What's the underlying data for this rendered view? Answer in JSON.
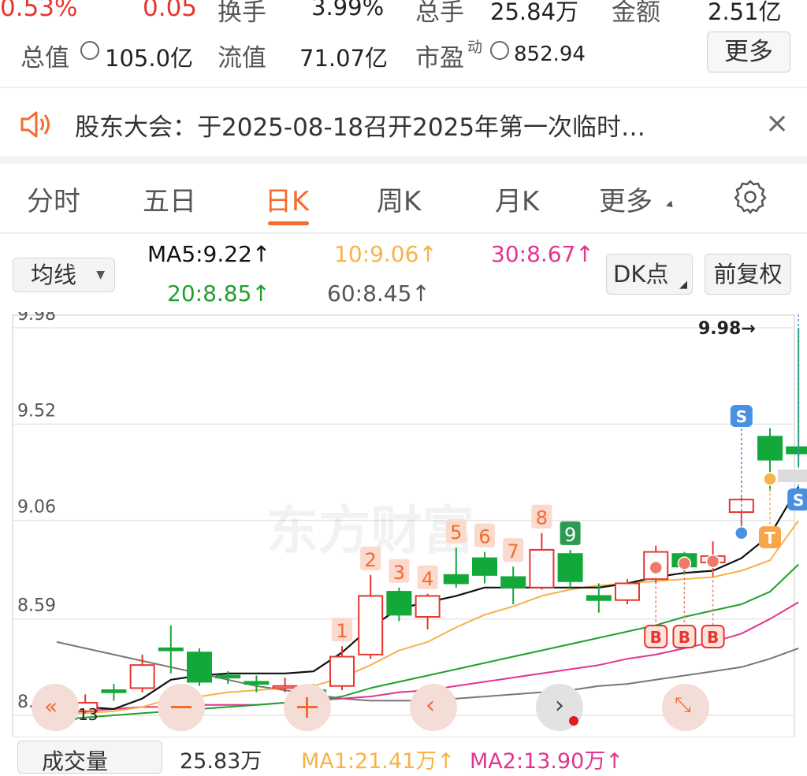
{
  "quote": {
    "change_pct": "0.53%",
    "change_amt": "0.05",
    "turnover_label": "换手",
    "turnover_value": "3.99%",
    "volume_label": "总手",
    "volume_value": "25.84万",
    "amount_label": "金额",
    "amount_value": "2.51亿",
    "mktcap_label": "总值",
    "mktcap_value": "105.0亿",
    "float_label": "流值",
    "float_value": "71.07亿",
    "pe_label": "市盈",
    "pe_sup": "动",
    "pe_value": "852.94",
    "more_button": "更多"
  },
  "notice": {
    "text": "股东大会：于2025-08-18召开2025年第一次临时…",
    "close_icon": "×"
  },
  "tabs": [
    {
      "label": "分时",
      "active": false
    },
    {
      "label": "五日",
      "active": false
    },
    {
      "label": "日K",
      "active": true
    },
    {
      "label": "周K",
      "active": false
    },
    {
      "label": "月K",
      "active": false
    },
    {
      "label": "更多",
      "active": false
    }
  ],
  "indicators": {
    "selector": "均线",
    "ma5": "MA5:9.22↑",
    "ma10": "10:9.06↑",
    "ma30": "30:8.67↑",
    "ma20": "20:8.85↑",
    "ma60": "60:8.45↑",
    "dk_button": "DK点",
    "adjust_button": "前复权"
  },
  "colors": {
    "up": "#e8352f",
    "down": "#13a83a",
    "accent": "#f36b2e",
    "ma5": "#111111",
    "ma10": "#f7b24a",
    "ma20": "#1fa12c",
    "ma30": "#e0358f",
    "ma60": "#777777"
  },
  "chart_data": {
    "type": "candlestick",
    "y_ticks": [
      "9.98",
      "9.52",
      "9.06",
      "8.59",
      "8.13"
    ],
    "ylim": [
      8.13,
      9.98
    ],
    "max_label": "9.98→",
    "low_label": "8.13",
    "watermark": "东方财富",
    "candles": [
      {
        "o": 8.11,
        "c": 8.13,
        "h": 8.14,
        "l": 8.1
      },
      {
        "o": 8.15,
        "c": 8.19,
        "h": 8.23,
        "l": 8.14
      },
      {
        "o": 8.25,
        "c": 8.24,
        "h": 8.28,
        "l": 8.2
      },
      {
        "o": 8.26,
        "c": 8.37,
        "h": 8.42,
        "l": 8.24
      },
      {
        "o": 8.45,
        "c": 8.44,
        "h": 8.56,
        "l": 8.33
      },
      {
        "o": 8.43,
        "c": 8.29,
        "h": 8.45,
        "l": 8.27
      },
      {
        "o": 8.32,
        "c": 8.31,
        "h": 8.34,
        "l": 8.28
      },
      {
        "o": 8.29,
        "c": 8.28,
        "h": 8.32,
        "l": 8.24
      },
      {
        "o": 8.27,
        "c": 8.27,
        "h": 8.31,
        "l": 8.24
      },
      {
        "o": 8.25,
        "c": 8.24,
        "h": 8.28,
        "l": 8.2
      },
      {
        "o": 8.27,
        "c": 8.41,
        "h": 8.46,
        "l": 8.25
      },
      {
        "o": 8.42,
        "c": 8.7,
        "h": 8.8,
        "l": 8.4
      },
      {
        "o": 8.72,
        "c": 8.61,
        "h": 8.74,
        "l": 8.58
      },
      {
        "o": 8.6,
        "c": 8.7,
        "h": 8.71,
        "l": 8.54
      },
      {
        "o": 8.8,
        "c": 8.76,
        "h": 8.93,
        "l": 8.74
      },
      {
        "o": 8.88,
        "c": 8.8,
        "h": 8.91,
        "l": 8.76
      },
      {
        "o": 8.79,
        "c": 8.74,
        "h": 8.84,
        "l": 8.66
      },
      {
        "o": 8.74,
        "c": 8.92,
        "h": 9.0,
        "l": 8.73
      },
      {
        "o": 8.9,
        "c": 8.77,
        "h": 8.92,
        "l": 8.74
      },
      {
        "o": 8.7,
        "c": 8.68,
        "h": 8.76,
        "l": 8.62
      },
      {
        "o": 8.68,
        "c": 8.76,
        "h": 8.78,
        "l": 8.66
      },
      {
        "o": 8.78,
        "c": 8.91,
        "h": 8.94,
        "l": 8.76
      },
      {
        "o": 8.9,
        "c": 8.84,
        "h": 8.91,
        "l": 8.8
      },
      {
        "o": 8.86,
        "c": 8.89,
        "h": 8.96,
        "l": 8.79
      },
      {
        "o": 9.1,
        "c": 9.16,
        "h": 9.17,
        "l": 9.0
      },
      {
        "o": 9.46,
        "c": 9.35,
        "h": 9.5,
        "l": 9.2
      },
      {
        "o": 9.41,
        "c": 9.38,
        "h": 9.98,
        "l": 9.32
      }
    ],
    "ma5": [
      8.17,
      8.17,
      8.16,
      8.21,
      8.3,
      8.32,
      8.33,
      8.33,
      8.33,
      8.34,
      8.43,
      8.55,
      8.64,
      8.67,
      8.7,
      8.74,
      8.74,
      8.74,
      8.74,
      8.74,
      8.76,
      8.79,
      8.81,
      8.82,
      8.88,
      8.99,
      9.22
    ],
    "ma10": [
      8.14,
      8.14,
      8.15,
      8.17,
      8.21,
      8.22,
      8.24,
      8.25,
      8.26,
      8.27,
      8.31,
      8.37,
      8.44,
      8.48,
      8.55,
      8.61,
      8.65,
      8.7,
      8.73,
      8.75,
      8.76,
      8.77,
      8.78,
      8.79,
      8.82,
      8.87,
      9.06
    ],
    "ma20": [
      8.11,
      8.12,
      8.13,
      8.14,
      8.15,
      8.16,
      8.17,
      8.18,
      8.19,
      8.2,
      8.22,
      8.26,
      8.29,
      8.32,
      8.35,
      8.38,
      8.41,
      8.44,
      8.47,
      8.5,
      8.53,
      8.56,
      8.6,
      8.63,
      8.66,
      8.72,
      8.85
    ],
    "ma30": [
      8.14,
      8.15,
      8.16,
      8.17,
      8.17,
      8.18,
      8.18,
      8.18,
      8.19,
      8.2,
      8.21,
      8.22,
      8.24,
      8.25,
      8.27,
      8.29,
      8.31,
      8.33,
      8.35,
      8.37,
      8.4,
      8.42,
      8.45,
      8.48,
      8.52,
      8.59,
      8.67
    ],
    "ma60": [
      8.48,
      8.45,
      8.42,
      8.39,
      8.36,
      8.33,
      8.3,
      8.27,
      8.25,
      8.23,
      8.21,
      8.2,
      8.2,
      8.2,
      8.21,
      8.22,
      8.23,
      8.24,
      8.25,
      8.27,
      8.28,
      8.3,
      8.32,
      8.34,
      8.36,
      8.4,
      8.45
    ],
    "count_labels": [
      {
        "i": 10,
        "t": "1"
      },
      {
        "i": 11,
        "t": "2"
      },
      {
        "i": 12,
        "t": "3"
      },
      {
        "i": 13,
        "t": "4"
      },
      {
        "i": 14,
        "t": "5"
      },
      {
        "i": 15,
        "t": "6"
      },
      {
        "i": 16,
        "t": "7"
      },
      {
        "i": 17,
        "t": "8"
      },
      {
        "i": 18,
        "t": "9",
        "green": true
      }
    ],
    "buy_markers": [
      21,
      22,
      23
    ],
    "sell_markers": [
      24,
      26
    ],
    "t_marker": 25
  },
  "bottom": {
    "volume_tab": "成交量",
    "volume_value": "25.83万",
    "ma_vol1": "MA1:21.41万↑",
    "ma_vol2": "MA2:13.90万↑"
  }
}
